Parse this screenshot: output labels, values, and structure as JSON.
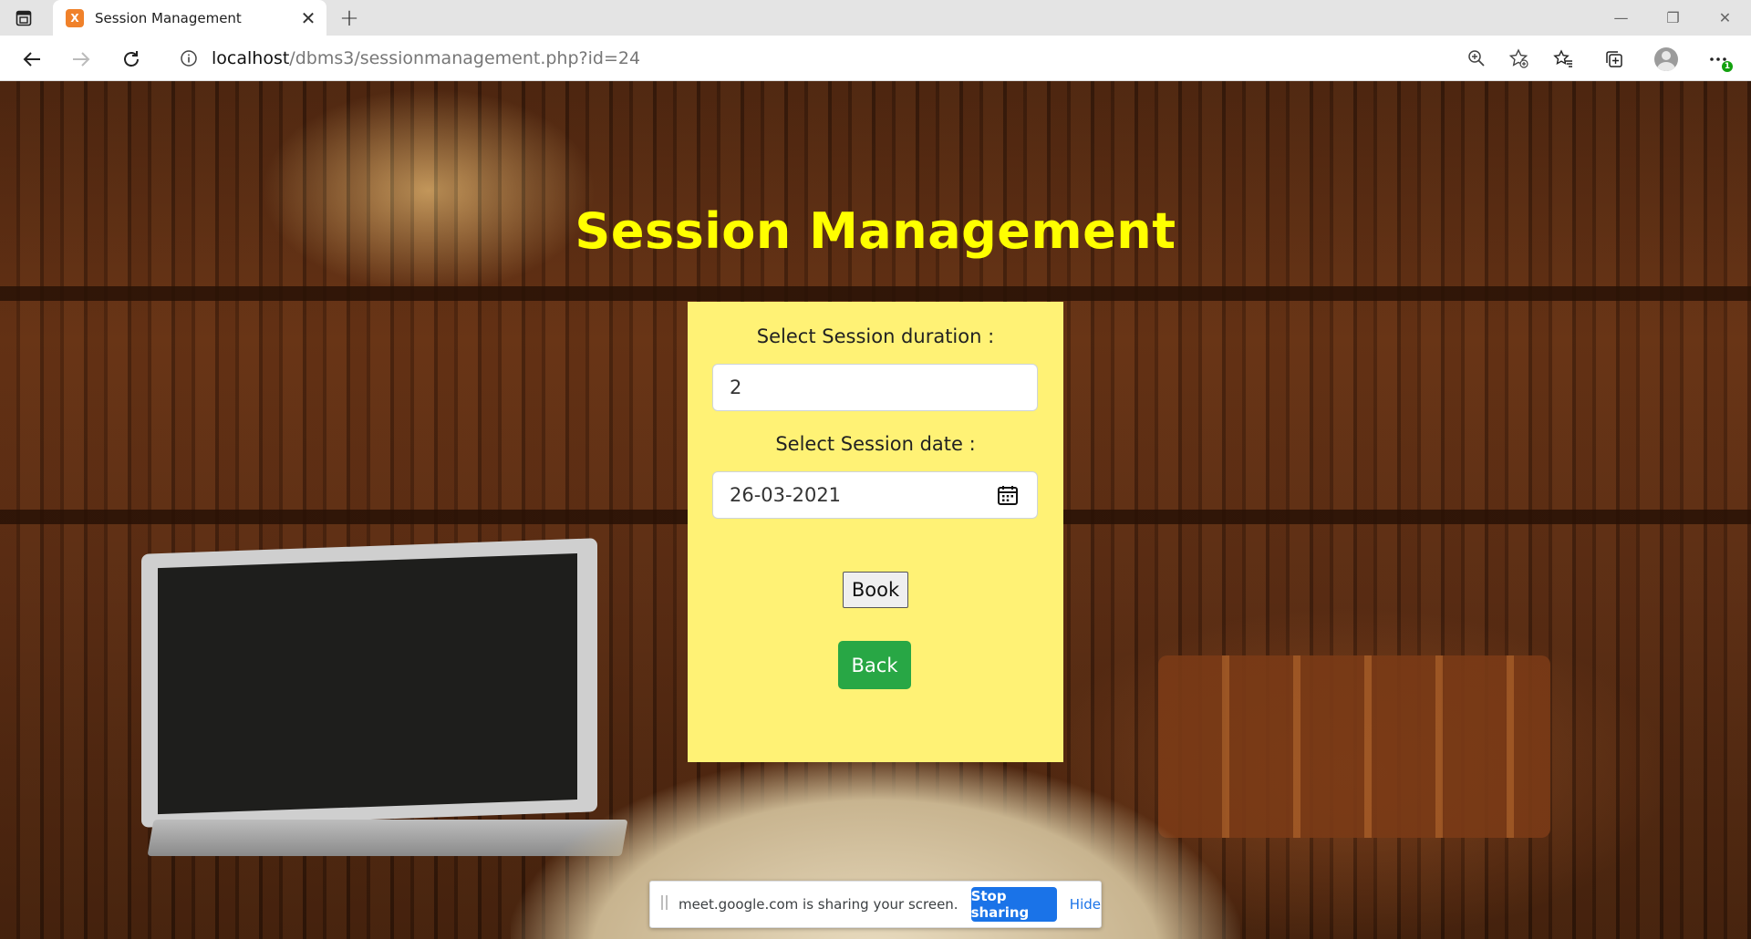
{
  "browser": {
    "tab_title": "Session Management",
    "favicon_label": "X",
    "tab_close": "✕",
    "new_tab": "+",
    "window": {
      "minimize": "—",
      "restore": "❐",
      "close": "✕"
    },
    "url_host": "localhost",
    "url_path": "/dbms3/sessionmanagement.php?id=24",
    "icons": [
      "tab-actions-icon",
      "back-icon",
      "forward-icon",
      "refresh-icon",
      "site-info-icon",
      "zoom-icon",
      "add-favorite-icon",
      "favorites-icon",
      "collections-icon",
      "profile-avatar",
      "settings-more-icon"
    ],
    "notification_badge": "1"
  },
  "page": {
    "title": "Session Management",
    "form": {
      "duration_label": "Select Session duration :",
      "duration_value": "2",
      "date_label": "Select Session date :",
      "date_value": "26-03-2021",
      "book_label": "Book",
      "back_label": "Back"
    },
    "colors": {
      "title": "#ffff00",
      "card": "#fff275",
      "back_button": "#28a745"
    }
  },
  "share_bar": {
    "message": "meet.google.com is sharing your screen.",
    "stop_label": "Stop sharing",
    "hide_label": "Hide"
  }
}
